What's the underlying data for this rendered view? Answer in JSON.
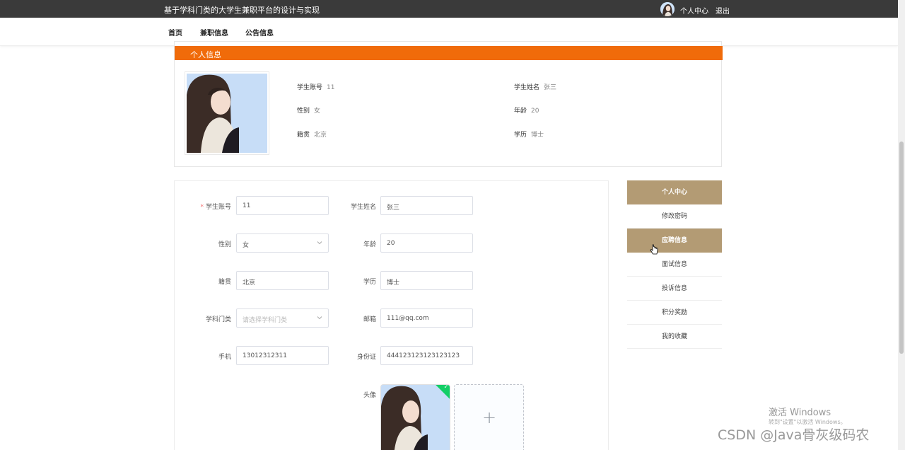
{
  "header": {
    "site_title": "基于学科门类的大学生兼职平台的设计与实现",
    "user_center": "个人中心",
    "logout": "退出"
  },
  "nav": {
    "items": [
      "首页",
      "兼职信息",
      "公告信息"
    ]
  },
  "profile": {
    "section_title": "个人信息",
    "fields": [
      {
        "label": "学生账号",
        "value": "11"
      },
      {
        "label": "学生姓名",
        "value": "张三"
      },
      {
        "label": "性别",
        "value": "女"
      },
      {
        "label": "年龄",
        "value": "20"
      },
      {
        "label": "籍贯",
        "value": "北京"
      },
      {
        "label": "学历",
        "value": "博士"
      }
    ]
  },
  "form": {
    "student_account": {
      "label": "学生账号",
      "value": "11",
      "required_mark": "*"
    },
    "student_name": {
      "label": "学生姓名",
      "value": "张三"
    },
    "gender": {
      "label": "性别",
      "value": "女"
    },
    "age": {
      "label": "年龄",
      "value": "20"
    },
    "hometown": {
      "label": "籍贯",
      "value": "北京"
    },
    "education": {
      "label": "学历",
      "value": "博士"
    },
    "discipline": {
      "label": "学科门类",
      "placeholder": "请选择学科门类"
    },
    "email": {
      "label": "邮箱",
      "value": "111@qq.com"
    },
    "phone": {
      "label": "手机",
      "value": "13012312311"
    },
    "id_card": {
      "label": "身份证",
      "value": "444123123123123123"
    },
    "avatar": {
      "label": "头像",
      "upload_icon": "+"
    }
  },
  "side_menu": {
    "items": [
      "个人中心",
      "修改密码",
      "应聘信息",
      "面试信息",
      "投诉信息",
      "积分奖励",
      "我的收藏"
    ]
  },
  "watermark": {
    "activate_title": "激活 Windows",
    "activate_sub": "转到\"设置\"以激活 Windows。",
    "csdn": "CSDN @Java骨灰级码农"
  },
  "colors": {
    "topbar": "#3a3a3a",
    "profile_header": "#f06b0a",
    "side_active": "#b39b74",
    "success": "#13ce66"
  }
}
